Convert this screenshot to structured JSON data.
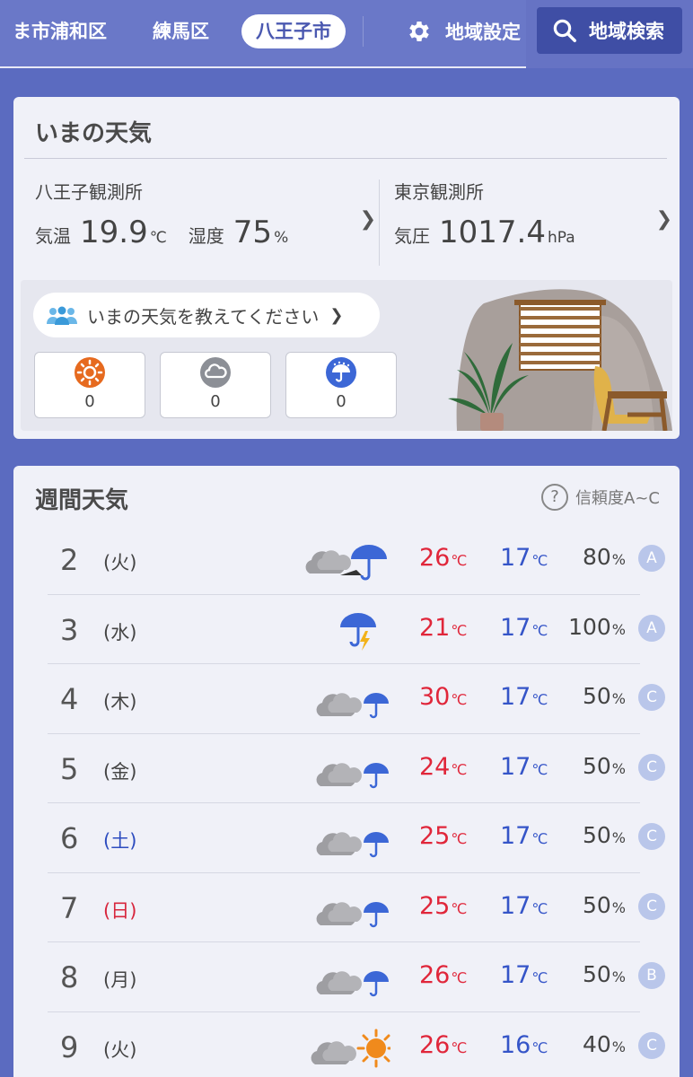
{
  "nav": {
    "tabs": [
      {
        "label": "ま市浦和区"
      },
      {
        "label": "練馬区"
      },
      {
        "label": "八王子市"
      }
    ],
    "settings_label": "地域設定",
    "search_label": "地域検索"
  },
  "now": {
    "title": "いまの天気",
    "station_a": {
      "name": "八王子観測所",
      "temp_label": "気温",
      "temp_value": "19.9",
      "temp_unit": "℃",
      "humidity_label": "湿度",
      "humidity_value": "75",
      "humidity_unit": "%"
    },
    "station_b": {
      "name": "東京観測所",
      "pressure_label": "気圧",
      "pressure_value": "1017.4",
      "pressure_unit": "hPa"
    },
    "report_prompt": "いまの天気を教えてください",
    "report_buttons": [
      {
        "icon": "sunny-icon",
        "count": "0"
      },
      {
        "icon": "cloudy-icon",
        "count": "0"
      },
      {
        "icon": "rainy-icon",
        "count": "0"
      }
    ]
  },
  "week": {
    "title": "週間天気",
    "reliability_label": "信頼度A~C",
    "temp_unit": "℃",
    "pop_unit": "%",
    "days": [
      {
        "date": "2",
        "dow": "(火)",
        "icon": "cloudy-then-rain-icon",
        "high": "26",
        "low": "17",
        "pop": "80",
        "rel": "A"
      },
      {
        "date": "3",
        "dow": "(水)",
        "icon": "rain-thunder-icon",
        "high": "21",
        "low": "17",
        "pop": "100",
        "rel": "A"
      },
      {
        "date": "4",
        "dow": "(木)",
        "icon": "cloudy-rain-icon",
        "high": "30",
        "low": "17",
        "pop": "50",
        "rel": "C"
      },
      {
        "date": "5",
        "dow": "(金)",
        "icon": "cloudy-rain-icon",
        "high": "24",
        "low": "17",
        "pop": "50",
        "rel": "C"
      },
      {
        "date": "6",
        "dow": "(土)",
        "icon": "cloudy-rain-icon",
        "high": "25",
        "low": "17",
        "pop": "50",
        "rel": "C"
      },
      {
        "date": "7",
        "dow": "(日)",
        "icon": "cloudy-rain-icon",
        "high": "25",
        "low": "17",
        "pop": "50",
        "rel": "C"
      },
      {
        "date": "8",
        "dow": "(月)",
        "icon": "cloudy-rain-icon",
        "high": "26",
        "low": "17",
        "pop": "50",
        "rel": "B"
      },
      {
        "date": "9",
        "dow": "(火)",
        "icon": "cloudy-sun-icon",
        "high": "26",
        "low": "16",
        "pop": "40",
        "rel": "C"
      }
    ]
  },
  "colors": {
    "header_bg": "#6a78c8",
    "page_bg": "#5b6bc0",
    "high_temp": "#e0263a",
    "low_temp": "#3555c8",
    "saturday": "#2d4cbf",
    "sunday": "#d7263d"
  }
}
